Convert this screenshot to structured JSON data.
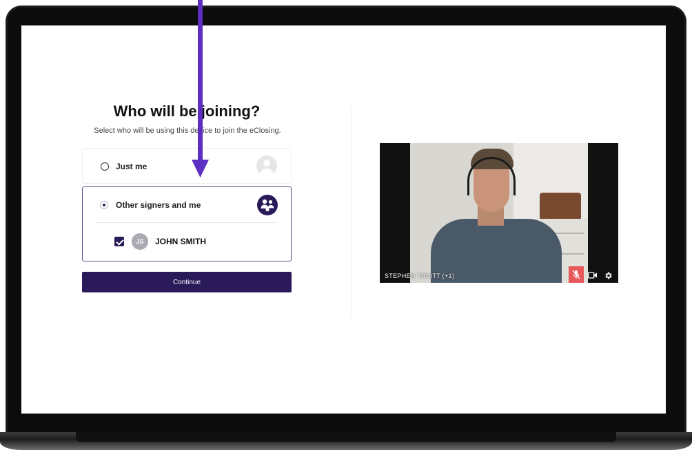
{
  "page": {
    "heading": "Who will be joining?",
    "subheading": "Select who will be using this device to join the eClosing."
  },
  "options": {
    "just_me": {
      "label": "Just me",
      "selected": false,
      "icon": "person-icon"
    },
    "others": {
      "label": "Other signers and me",
      "selected": true,
      "icon": "group-icon"
    }
  },
  "signer": {
    "initials": "JS",
    "name": "JOHN SMITH",
    "checked": true
  },
  "buttons": {
    "continue_label": "Continue"
  },
  "video": {
    "participant_label": "STEPHEN TRUITT (+1)",
    "controls": [
      "microphone-muted-icon",
      "camera-icon",
      "gear-icon"
    ]
  },
  "colors": {
    "brand": "#2a1a5a",
    "annotation_arrow": "#5b2fc2",
    "mute": "#e8575a"
  }
}
